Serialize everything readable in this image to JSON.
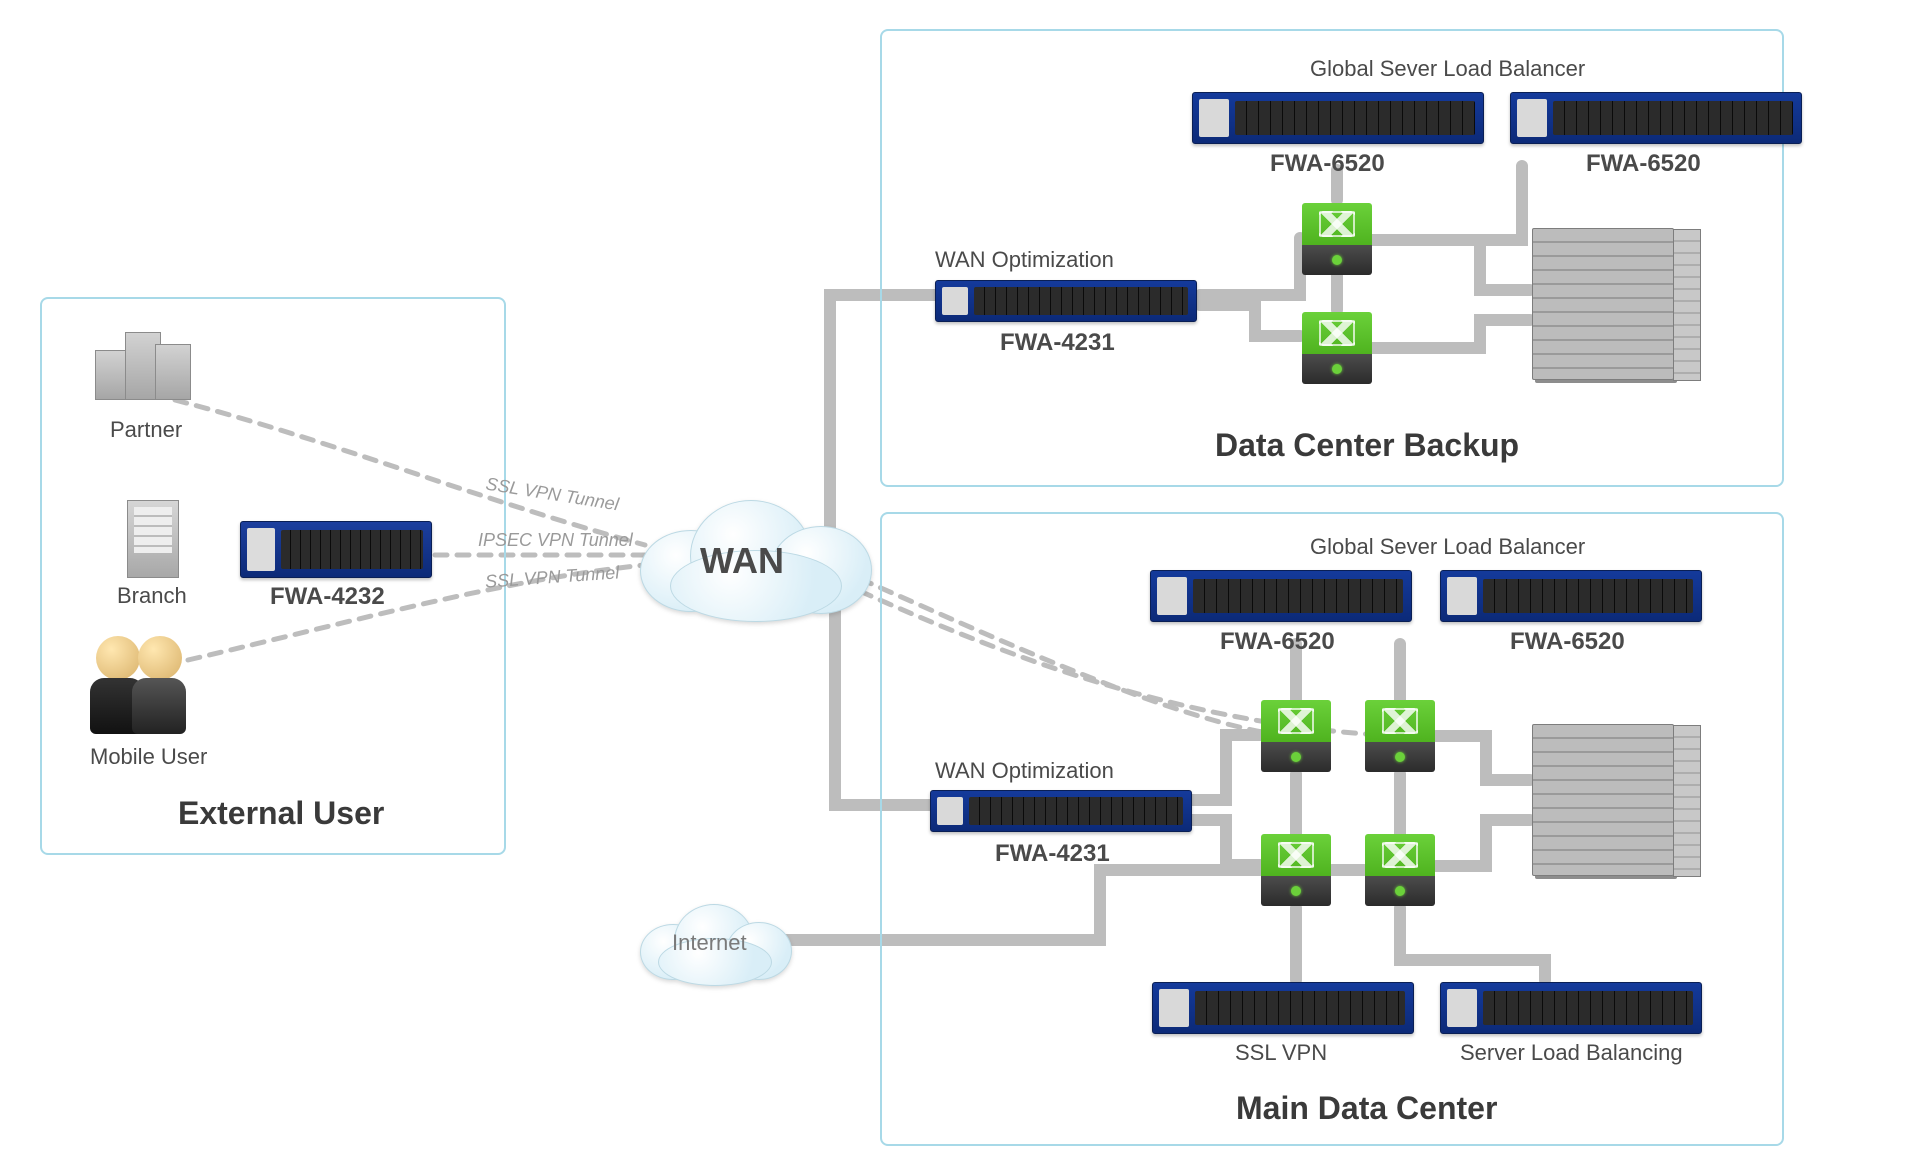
{
  "regions": {
    "external": {
      "title": "External User"
    },
    "backup": {
      "title": "Data Center Backup"
    },
    "main": {
      "title": "Main Data Center"
    }
  },
  "external": {
    "partner": "Partner",
    "branch": "Branch",
    "mobile": "Mobile User",
    "branch_device": "FWA-4232"
  },
  "wan": {
    "label": "WAN",
    "tunnels": {
      "partner": "SSL VPN Tunnel",
      "branch": "IPSEC VPN Tunnel",
      "mobile": "SSL VPN Tunnel"
    },
    "internet": "Internet"
  },
  "backup": {
    "gslb": "Global Sever Load Balancer",
    "dev_6520_a": "FWA-6520",
    "dev_6520_b": "FWA-6520",
    "wan_opt": "WAN Optimization",
    "dev_4231": "FWA-4231"
  },
  "main": {
    "gslb": "Global Sever Load Balancer",
    "dev_6520_a": "FWA-6520",
    "dev_6520_b": "FWA-6520",
    "wan_opt": "WAN Optimization",
    "dev_4231": "FWA-4231",
    "sslvpn": "SSL VPN",
    "slb": "Server Load Balancing"
  },
  "diagram": {
    "nodes": [
      {
        "id": "partner",
        "type": "org",
        "region": "external"
      },
      {
        "id": "branch-bldg",
        "type": "org",
        "region": "external"
      },
      {
        "id": "mobile-user",
        "type": "user",
        "region": "external"
      },
      {
        "id": "fwa-4232",
        "type": "appliance-1u",
        "region": "external"
      },
      {
        "id": "wan-cloud",
        "type": "cloud"
      },
      {
        "id": "internet-cloud",
        "type": "cloud"
      },
      {
        "id": "backup-6520-a",
        "type": "appliance-2u",
        "region": "backup"
      },
      {
        "id": "backup-6520-b",
        "type": "appliance-2u",
        "region": "backup"
      },
      {
        "id": "backup-4231",
        "type": "appliance-1u",
        "region": "backup"
      },
      {
        "id": "backup-switch-1",
        "type": "switch",
        "region": "backup"
      },
      {
        "id": "backup-switch-2",
        "type": "switch",
        "region": "backup"
      },
      {
        "id": "backup-rack",
        "type": "server-rack",
        "region": "backup"
      },
      {
        "id": "main-6520-a",
        "type": "appliance-2u",
        "region": "main"
      },
      {
        "id": "main-6520-b",
        "type": "appliance-2u",
        "region": "main"
      },
      {
        "id": "main-4231",
        "type": "appliance-1u",
        "region": "main"
      },
      {
        "id": "main-switch-1",
        "type": "switch",
        "region": "main"
      },
      {
        "id": "main-switch-2",
        "type": "switch",
        "region": "main"
      },
      {
        "id": "main-switch-3",
        "type": "switch",
        "region": "main"
      },
      {
        "id": "main-switch-4",
        "type": "switch",
        "region": "main"
      },
      {
        "id": "main-rack",
        "type": "server-rack",
        "region": "main"
      },
      {
        "id": "main-sslvpn",
        "type": "appliance-2u",
        "region": "main"
      },
      {
        "id": "main-slb",
        "type": "appliance-2u",
        "region": "main"
      }
    ],
    "edges": [
      {
        "from": "partner",
        "to": "wan-cloud",
        "style": "dashed",
        "label": "SSL VPN Tunnel"
      },
      {
        "from": "fwa-4232",
        "to": "wan-cloud",
        "style": "dashed",
        "label": "IPSEC VPN Tunnel"
      },
      {
        "from": "mobile-user",
        "to": "wan-cloud",
        "style": "dashed",
        "label": "SSL VPN Tunnel"
      },
      {
        "from": "wan-cloud",
        "to": "backup-4231",
        "style": "solid"
      },
      {
        "from": "wan-cloud",
        "to": "main-4231",
        "style": "solid"
      },
      {
        "from": "wan-cloud",
        "to": "main-switch-1",
        "style": "dashed"
      },
      {
        "from": "wan-cloud",
        "to": "main-switch-2",
        "style": "dashed"
      },
      {
        "from": "backup-4231",
        "to": "backup-switch-1",
        "style": "solid"
      },
      {
        "from": "backup-4231",
        "to": "backup-switch-2",
        "style": "solid"
      },
      {
        "from": "backup-6520-a",
        "to": "backup-switch-1",
        "style": "solid"
      },
      {
        "from": "backup-6520-b",
        "to": "backup-switch-1",
        "style": "solid"
      },
      {
        "from": "backup-switch-1",
        "to": "backup-switch-2",
        "style": "solid"
      },
      {
        "from": "backup-switch-2",
        "to": "backup-rack",
        "style": "solid"
      },
      {
        "from": "backup-switch-1",
        "to": "backup-rack",
        "style": "solid"
      },
      {
        "from": "main-4231",
        "to": "main-switch-1",
        "style": "solid"
      },
      {
        "from": "main-4231",
        "to": "main-switch-3",
        "style": "solid"
      },
      {
        "from": "main-6520-a",
        "to": "main-switch-1",
        "style": "solid"
      },
      {
        "from": "main-6520-b",
        "to": "main-switch-2",
        "style": "solid"
      },
      {
        "from": "main-switch-1",
        "to": "main-switch-3",
        "style": "solid"
      },
      {
        "from": "main-switch-2",
        "to": "main-switch-4",
        "style": "solid"
      },
      {
        "from": "main-switch-2",
        "to": "main-rack",
        "style": "solid"
      },
      {
        "from": "main-switch-4",
        "to": "main-rack",
        "style": "solid"
      },
      {
        "from": "main-switch-3",
        "to": "main-sslvpn",
        "style": "solid"
      },
      {
        "from": "main-switch-4",
        "to": "main-slb",
        "style": "solid"
      },
      {
        "from": "internet-cloud",
        "to": "main-switch-3",
        "style": "solid"
      },
      {
        "from": "internet-cloud",
        "to": "main-switch-4",
        "style": "solid"
      }
    ]
  }
}
